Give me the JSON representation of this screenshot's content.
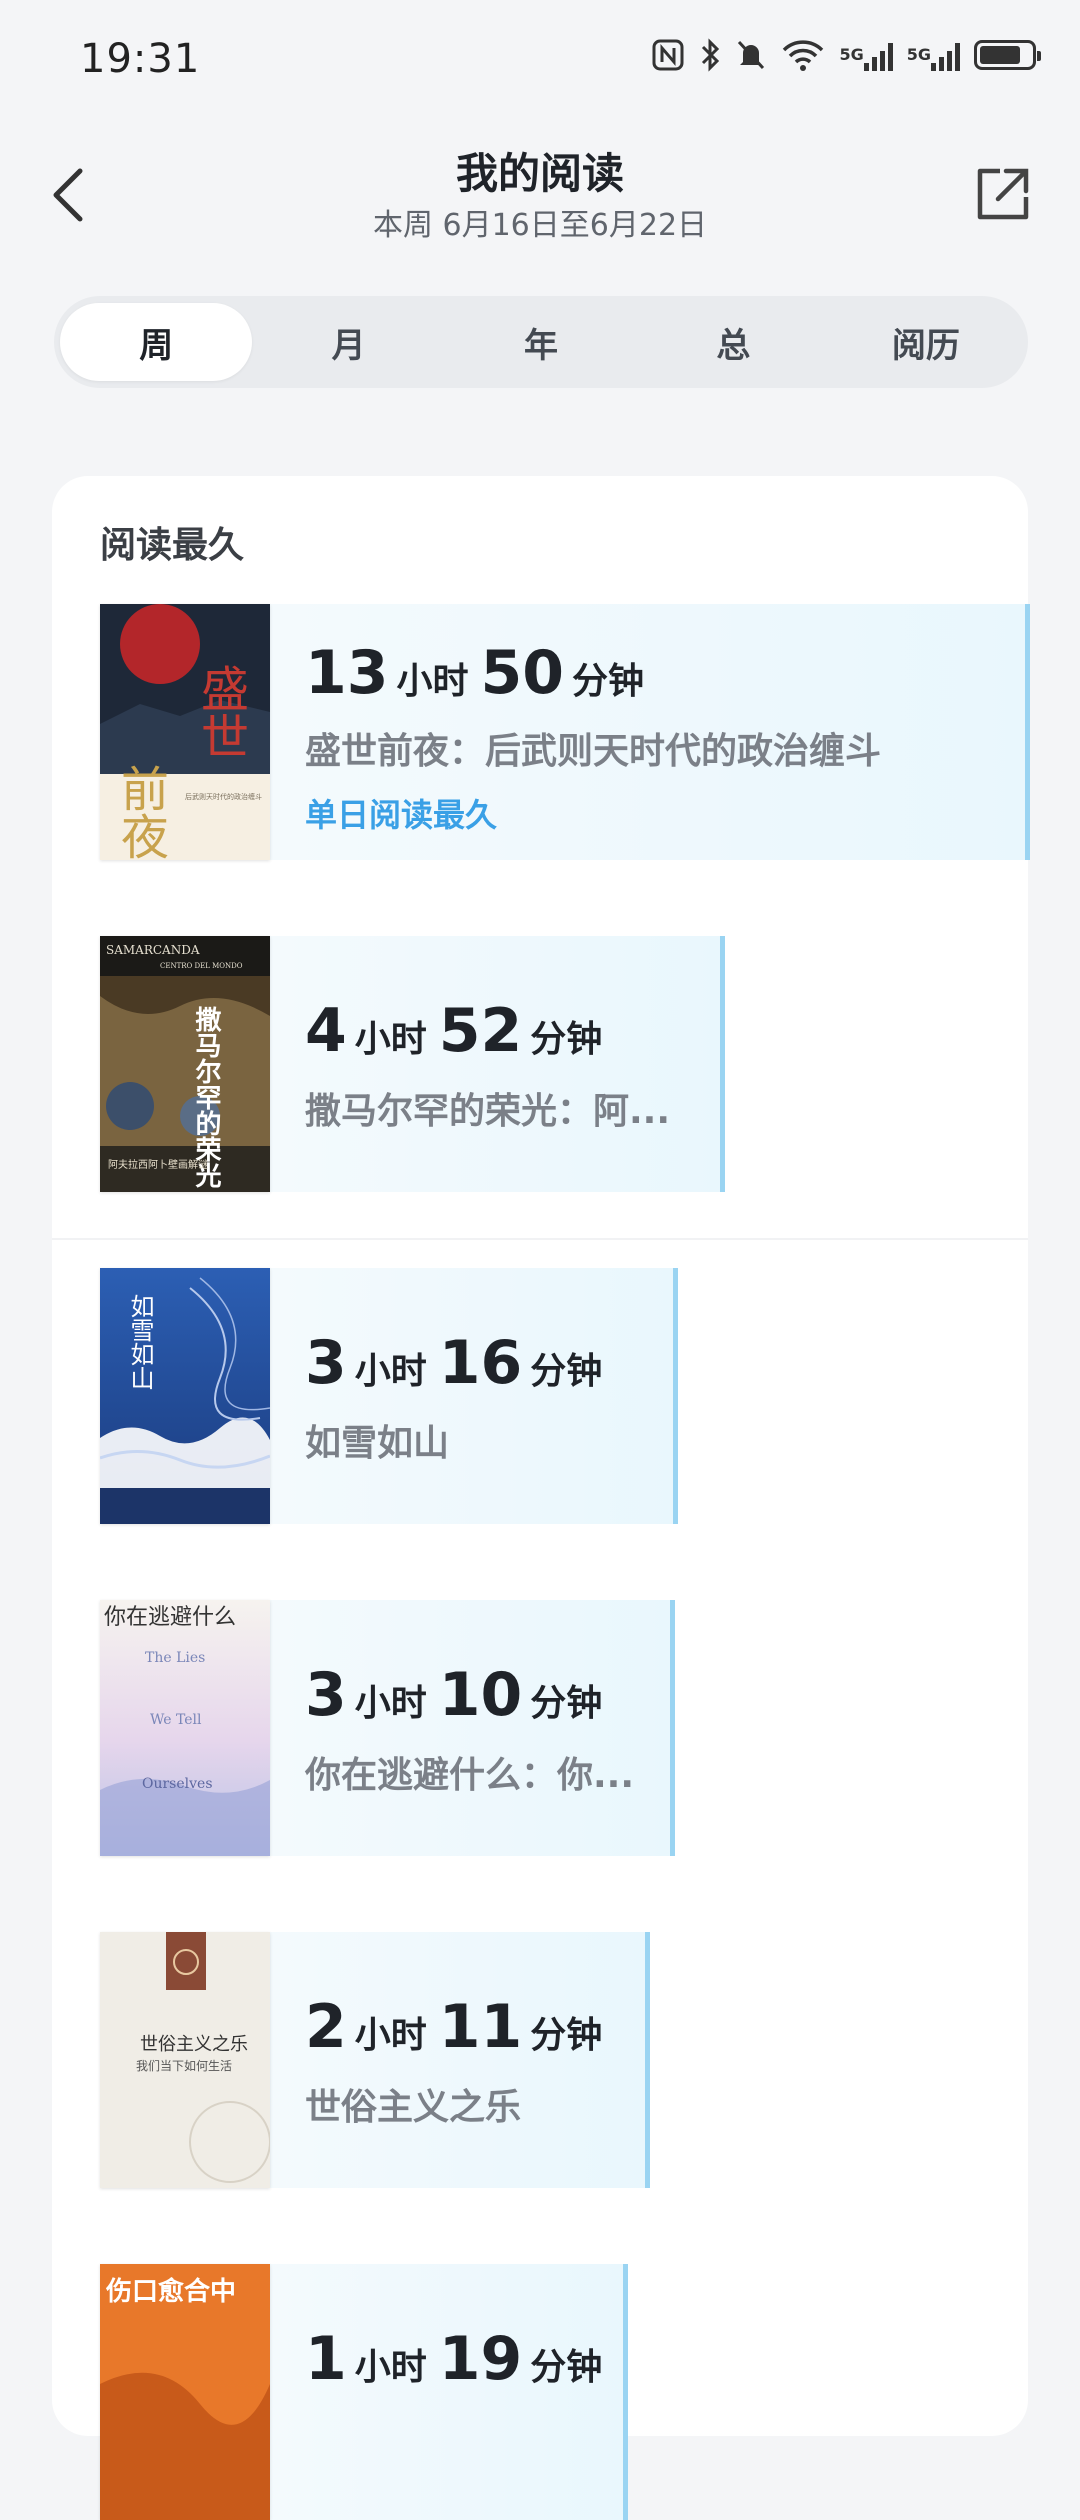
{
  "status": {
    "time": "19:31",
    "net1": "5G",
    "net2": "5G"
  },
  "header": {
    "title": "我的阅读",
    "subtitle": "本周 6月16日至6月22日"
  },
  "tabs": [
    {
      "label": "周",
      "active": true
    },
    {
      "label": "月"
    },
    {
      "label": "年"
    },
    {
      "label": "总"
    },
    {
      "label": "阅历"
    }
  ],
  "section": {
    "title": "阅读最久"
  },
  "books": [
    {
      "hours": "13",
      "minutes": "50",
      "title": "盛世前夜：后武则天时代的政治缠斗",
      "badge": "单日阅读最久",
      "cover": {
        "title": "盛世",
        "title2": "前夜",
        "side": "后武则天时代的政治缠斗"
      }
    },
    {
      "hours": "4",
      "minutes": "52",
      "title": "撒马尔罕的荣光：阿...",
      "cover": {
        "top": "SAMARCANDA",
        "top2": "CENTRO DEL MONDO",
        "title": "撒马尔罕的荣光",
        "bottom": "阿夫拉西阿卜壁画解谜"
      }
    },
    {
      "hours": "3",
      "minutes": "16",
      "title": "如雪如山",
      "cover": {
        "title": "如雪如山"
      }
    },
    {
      "hours": "3",
      "minutes": "10",
      "title": "你在逃避什么：你...",
      "cover": {
        "title": "你在逃避什么",
        "en1": "The Lies",
        "en2": "We Tell",
        "en3": "Ourselves"
      }
    },
    {
      "hours": "2",
      "minutes": "11",
      "title": "世俗主义之乐",
      "cover": {
        "title": "世俗主义之乐",
        "sub": "我们当下如何生活"
      }
    },
    {
      "hours": "1",
      "minutes": "19",
      "title": "",
      "cover": {
        "title": "伤口愈合中"
      }
    }
  ],
  "units": {
    "hour": "小时",
    "minute": "分钟"
  }
}
